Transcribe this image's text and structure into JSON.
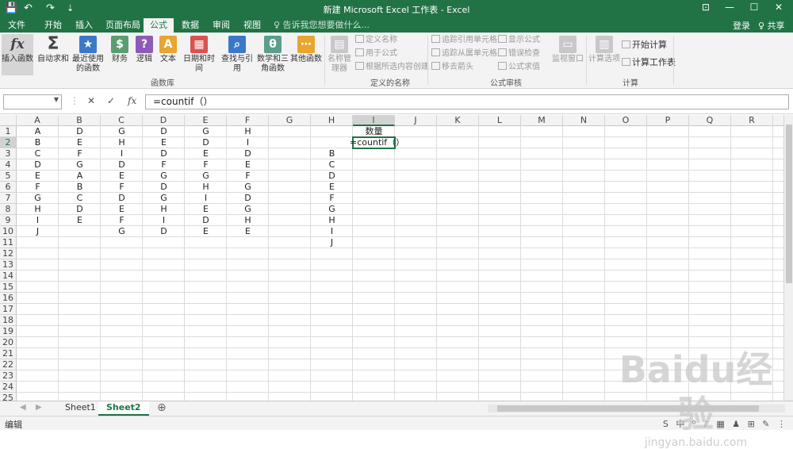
{
  "titlebar": {
    "title": "新建 Microsoft Excel 工作表 - Excel",
    "qa_save": "💾",
    "qa_undo": "↶",
    "qa_redo": "↷",
    "qa_custom": "⇣",
    "wc_ribbon": "⊡",
    "wc_min": "—",
    "wc_max": "☐",
    "wc_close": "✕"
  },
  "tabs": [
    {
      "label": "文件"
    },
    {
      "label": "开始"
    },
    {
      "label": "插入"
    },
    {
      "label": "页面布局"
    },
    {
      "label": "公式"
    },
    {
      "label": "数据"
    },
    {
      "label": "审阅"
    },
    {
      "label": "视图"
    },
    {
      "label": "♀ 告诉我您想要做什么..."
    }
  ],
  "account": {
    "login": "登录",
    "share": "♀ 共享"
  },
  "ribbon": {
    "buttons": [
      {
        "label": "插入函数",
        "icon": "fx"
      },
      {
        "label": "自动求和",
        "icon": "Σ"
      },
      {
        "label": "最近使用的函数",
        "icon": "★"
      },
      {
        "label": "财务",
        "icon": "$"
      },
      {
        "label": "逻辑",
        "icon": "?"
      },
      {
        "label": "文本",
        "icon": "A"
      },
      {
        "label": "日期和时间",
        "icon": "▦"
      },
      {
        "label": "查找与引用",
        "icon": "⌕"
      },
      {
        "label": "数学和三角函数",
        "icon": "θ"
      },
      {
        "label": "其他函数",
        "icon": "⋯"
      },
      {
        "label": "名称管理器",
        "icon": "▤"
      },
      {
        "label": "监视窗口",
        "icon": "▭"
      },
      {
        "label": "计算选项",
        "icon": "▥"
      }
    ],
    "small": [
      {
        "label": "定义名称"
      },
      {
        "label": "用于公式"
      },
      {
        "label": "根据所选内容创建"
      },
      {
        "label": "追踪引用单元格"
      },
      {
        "label": "追踪从属单元格"
      },
      {
        "label": "移去箭头"
      },
      {
        "label": "显示公式"
      },
      {
        "label": "错误检查"
      },
      {
        "label": "公式求值"
      },
      {
        "label": "开始计算"
      },
      {
        "label": "计算工作表"
      }
    ],
    "groups": [
      {
        "label": "函数库"
      },
      {
        "label": "定义的名称"
      },
      {
        "label": "公式审核"
      },
      {
        "label": "计算"
      }
    ]
  },
  "formula_bar": {
    "name_box": "",
    "cancel": "✕",
    "enter": "✓",
    "fx": "fx",
    "formula": "=countif（）"
  },
  "columns": [
    "A",
    "B",
    "C",
    "D",
    "E",
    "F",
    "G",
    "H",
    "I",
    "J",
    "K",
    "L",
    "M",
    "N",
    "O",
    "P",
    "Q",
    "R"
  ],
  "active_column": "I",
  "rows": [
    "1",
    "2",
    "3",
    "4",
    "5",
    "6",
    "7",
    "8",
    "9",
    "10",
    "11",
    "12",
    "13",
    "14",
    "15",
    "16",
    "17",
    "18",
    "19",
    "20",
    "21",
    "22",
    "23",
    "24",
    "25"
  ],
  "active_row": "2",
  "cells": {
    "A": [
      "A",
      "B",
      "C",
      "D",
      "E",
      "F",
      "G",
      "H",
      "I",
      "J"
    ],
    "B": [
      "D",
      "E",
      "F",
      "G",
      "A",
      "B",
      "C",
      "D",
      "E"
    ],
    "C": [
      "G",
      "H",
      "I",
      "D",
      "E",
      "F",
      "D",
      "E",
      "F",
      "G"
    ],
    "D": [
      "D",
      "E",
      "D",
      "F",
      "G",
      "D",
      "G",
      "H",
      "I",
      "D"
    ],
    "E": [
      "G",
      "D",
      "E",
      "F",
      "G",
      "H",
      "I",
      "E",
      "D",
      "E"
    ],
    "F": [
      "H",
      "I",
      "D",
      "E",
      "F",
      "G",
      "D",
      "G",
      "H",
      "E"
    ],
    "H": [
      "B",
      "C",
      "D",
      "E",
      "F",
      "G",
      "H",
      "I",
      "J"
    ],
    "I1": "数量",
    "I2": "=countif（）"
  },
  "sheets": [
    {
      "label": "Sheet1"
    },
    {
      "label": "Sheet2"
    }
  ],
  "active_sheet": "Sheet2",
  "add_sheet": "⊕",
  "status": {
    "mode": "编辑",
    "tray": "S 中 ⁰ ♪ ▦ ♟ ⊞ ✎ ⋮"
  },
  "watermark": {
    "main": "Baidu经验",
    "sub": "jingyan.baidu.com"
  }
}
